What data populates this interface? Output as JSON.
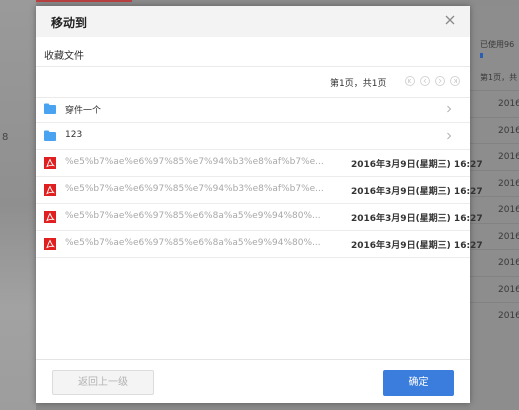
{
  "background": {
    "left_glyph": "8",
    "usage_label": "已使用96",
    "page_label": "第1页，共",
    "row_years": [
      "2016",
      "2016",
      "2016",
      "2016",
      "2016",
      "2016",
      "2016",
      "2016",
      "2016"
    ]
  },
  "dialog": {
    "title": "移动到",
    "breadcrumb": "收藏文件",
    "pagination": {
      "text": "第1页，共1页"
    },
    "items": [
      {
        "kind": "folder",
        "name": "穿件一个",
        "date": ""
      },
      {
        "kind": "folder",
        "name": "123",
        "date": ""
      },
      {
        "kind": "pdf",
        "name": "%e5%b7%ae%e6%97%85%e7%94%b3%e8%af%b7%e...",
        "date": "2016年3月9日(星期三) 16:27"
      },
      {
        "kind": "pdf",
        "name": "%e5%b7%ae%e6%97%85%e7%94%b3%e8%af%b7%e...",
        "date": "2016年3月9日(星期三) 16:27"
      },
      {
        "kind": "pdf",
        "name": "%e5%b7%ae%e6%97%85%e6%8a%a5%e9%94%80%...",
        "date": "2016年3月9日(星期三) 16:27"
      },
      {
        "kind": "pdf",
        "name": "%e5%b7%ae%e6%97%85%e6%8a%a5%e9%94%80%...",
        "date": "2016年3月9日(星期三) 16:27"
      }
    ],
    "back_button": "返回上一级",
    "confirm_button": "确定"
  },
  "colors": {
    "primary": "#3b7ddd",
    "folder": "#4aa3f0",
    "pdf": "#e02020"
  }
}
